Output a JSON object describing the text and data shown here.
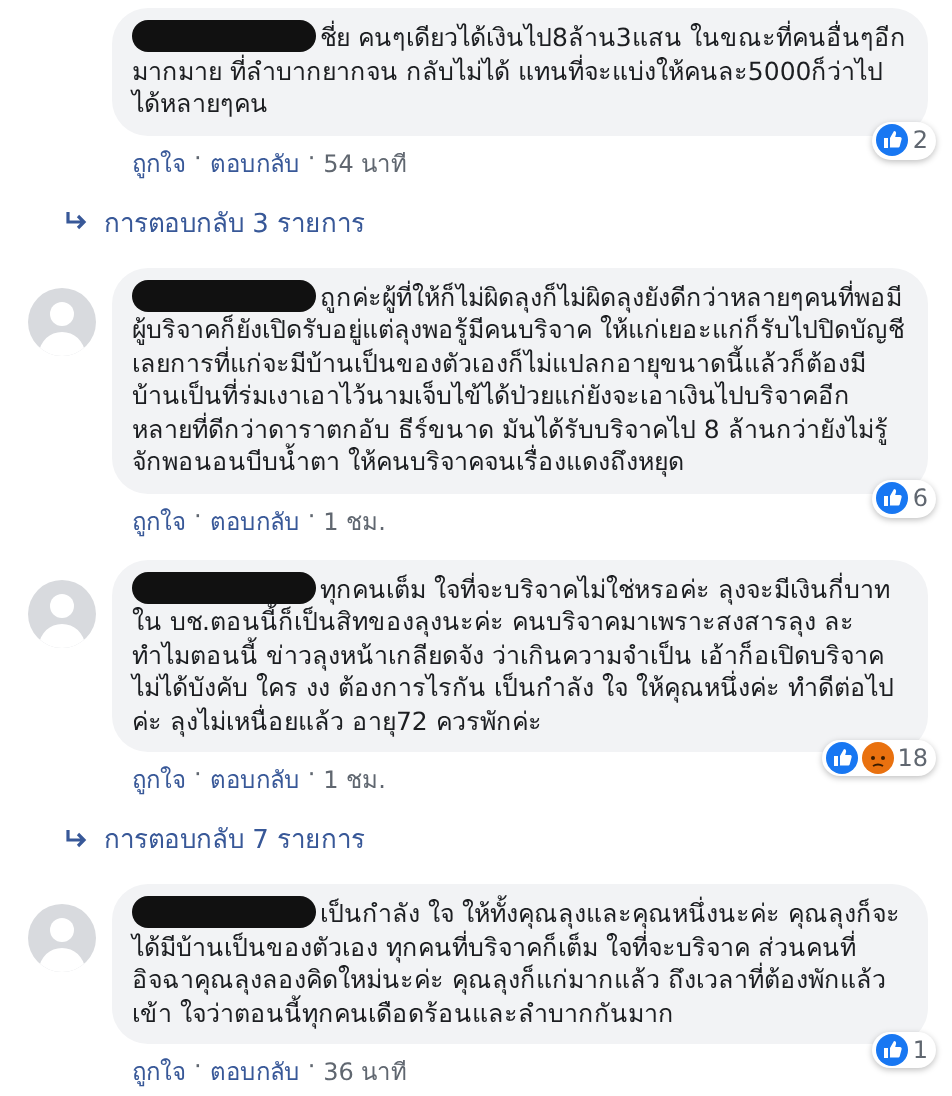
{
  "comments": [
    {
      "text": "ชี่ย คนๆเดียวได้เงินไป8ล้าน3แสน ในขณะที่คนอื่นๆอีกมากมาย ที่ลำบากยากจน กลับไม่ได้ แทนที่จะแบ่งให้คนละ5000ก็ว่าไป ได้หลายๆคน",
      "reactions": [
        {
          "kind": "like"
        }
      ],
      "reaction_count": "2",
      "actions": [
        "ถูกใจ",
        "ตอบกลับ",
        "54 นาที"
      ],
      "separator": "·",
      "replies": "การตอบกลับ 3 รายการ"
    },
    {
      "avatar": true,
      "text": "ถูกค่ะผู้ที่ให้ก็ไม่ผิดลุงก็ไม่ผิดลุงยังดีกว่าหลายๆคนที่พอมีผู้บริจาคก็ยังเปิดรับอยู่แต่ลุงพอรู้มีคนบริจาค ให้แก่เยอะแก่ก็รับไปปิดบัญชีเลยการที่แก่จะมีบ้านเป็นของตัวเองก็ไม่แปลกอายุขนาดนี้แล้วก็ต้องมีบ้านเป็นที่ร่มเงาเอาไว้นามเจ็บไข้ได้ป่วยแก่ยังจะเอาเงินไปบริจาคอีกหลายที่ดีกว่าดาราตกอับ ธีร์ขนาด มันได้รับบริจาคไป 8 ล้านกว่ายังไม่รู้จักพอนอนบีบน้ำตา ให้คนบริจาคจนเรื่องแดงถึงหยุด",
      "reactions": [
        {
          "kind": "like"
        }
      ],
      "reaction_count": "6",
      "actions": [
        "ถูกใจ",
        "ตอบกลับ",
        "1 ชม."
      ],
      "separator": "·"
    },
    {
      "avatar": true,
      "text": "ทุกคนเต็ม ใจที่จะบริจาคไม่ใช่หรอค่ะ ลุงจะมีเงินกี่บาท ใน บช.ตอนนี้ก็เป็นสิทของลุงนะค่ะ คนบริจาคมาเพราะสงสารลุง ละทำไมตอนนี้ ข่าวลุงหน้าเกลียดจัง ว่าเกินความจำเป็น เอ้าก็อเปิดบริจาค ไม่ได้บังคับ ใคร งง ต้องการไรกัน เป็นกำลัง ใจ ให้คุณหนึ่งค่ะ ทำดีต่อไปค่ะ ลุงไม่เหนื่อยแล้ว อายุ72 ควรพักค่ะ",
      "reactions": [
        {
          "kind": "like"
        },
        {
          "kind": "angry"
        }
      ],
      "reaction_count": "18",
      "actions": [
        "ถูกใจ",
        "ตอบกลับ",
        "1 ชม."
      ],
      "separator": "·",
      "replies": "การตอบกลับ 7 รายการ"
    },
    {
      "avatar": true,
      "text": "เป็นกำลัง ใจ ให้ทั้งคุณลุงและคุณหนึ่งนะค่ะ คุณลุงก็จะได้มีบ้านเป็นของตัวเอง ทุกคนที่บริจาคก็เต็ม ใจที่จะบริจาค ส่วนคนที่อิจฉาคุณลุงลองคิดใหม่นะค่ะ คุณลุงก็แก่มากแล้ว ถึงเวลาที่ต้องพักแล้ว เข้า ใจว่าตอนนี้ทุกคนเดือดร้อนและลำบากกันมาก",
      "reactions": [
        {
          "kind": "like"
        }
      ],
      "reaction_count": "1",
      "actions": [
        "ถูกใจ",
        "ตอบกลับ",
        "36 นาที"
      ],
      "separator": "·"
    }
  ]
}
